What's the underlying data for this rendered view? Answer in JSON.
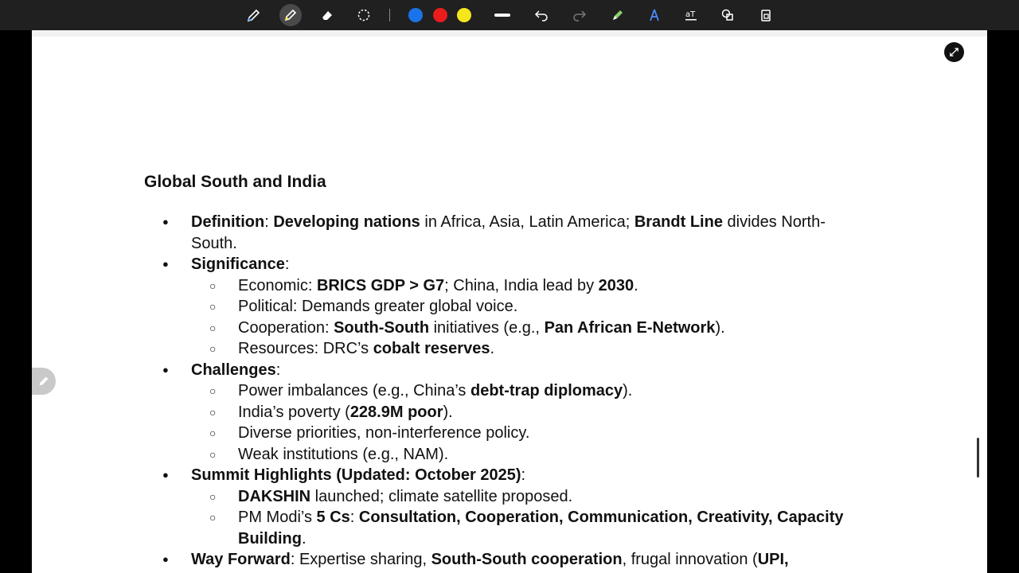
{
  "toolbar": {
    "tools": [
      "pen-icon",
      "highlighter-icon",
      "eraser-icon",
      "lasso-icon",
      "stroke-width-icon",
      "undo-icon",
      "redo-icon",
      "marker-icon",
      "ink-to-shape-icon",
      "text-recognition-icon",
      "shapes-icon",
      "lock-icon"
    ],
    "colors": [
      "#1a73e8",
      "#ea1c1c",
      "#f5e51b"
    ]
  },
  "doc": {
    "title": "Global South and India",
    "definition": {
      "label": "Definition",
      "colon": ":",
      "b1": "Developing nations",
      "t1": " in Africa, Asia, Latin America; ",
      "b2": "Brandt Line",
      "t2": " divides North-South."
    },
    "significance": {
      "label": "Significance",
      "colon": ":",
      "economic": {
        "t1": "Economic: ",
        "b1": "BRICS GDP > G7",
        "t2": "; China, India lead by ",
        "b2": "2030",
        "t3": "."
      },
      "political": {
        "t1": "Political: Demands greater global voice."
      },
      "cooperation": {
        "t1": "Cooperation: ",
        "b1": "South-South",
        "t2": " initiatives (e.g., ",
        "b2": "Pan African E-Network",
        "t3": ")."
      },
      "resources": {
        "t1": "Resources: DRC’s ",
        "b1": "cobalt reserves",
        "t2": "."
      }
    },
    "challenges": {
      "label": "Challenges",
      "colon": ":",
      "power": {
        "t1": "Power imbalances (e.g., China’s ",
        "b1": "debt-trap diplomacy",
        "t2": ")."
      },
      "poverty": {
        "t1": "India’s poverty (",
        "b1": "228.9M poor",
        "t2": ")."
      },
      "priorities": {
        "t1": "Diverse priorities, non-interference policy."
      },
      "institutions": {
        "t1": "Weak institutions (e.g., NAM)."
      }
    },
    "summit": {
      "label": "Summit Highlights (Updated: October 2025)",
      "colon": ":",
      "dakshin": {
        "b1": "DAKSHIN",
        "t1": " launched; climate satellite proposed."
      },
      "modi": {
        "t1": "PM Modi’s ",
        "b1": "5 Cs",
        "t2": ": ",
        "b2": "Consultation, Cooperation, Communication, Creativity, Capacity Building",
        "t3": "."
      }
    },
    "wayforward": {
      "label": "Way Forward",
      "t1": ": Expertise sharing, ",
      "b1": "South-South cooperation",
      "t2": ", frugal innovation (",
      "b2": "UPI,"
    }
  }
}
